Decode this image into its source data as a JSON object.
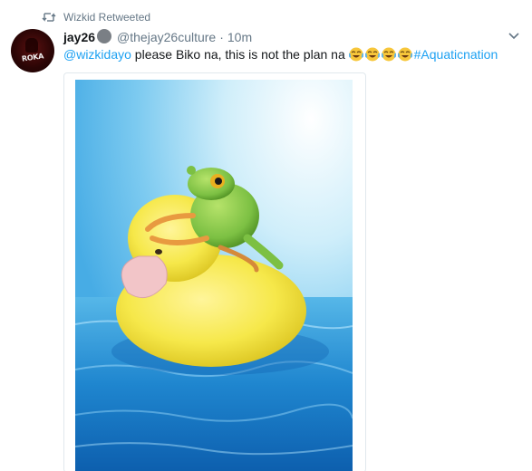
{
  "retweet": {
    "label": "Wizkid Retweeted",
    "icon": "retweet-icon"
  },
  "tweet": {
    "display_name": "jay26",
    "handle": "@thejay26culture",
    "separator": "·",
    "time": "10m",
    "avatar_text": "ROKA",
    "mention": "@wizkidayo",
    "body": " please Biko na, this is not the plan na ",
    "emoji": [
      "face-with-tears-of-joy",
      "face-with-tears-of-joy",
      "face-with-tears-of-joy",
      "face-with-tears-of-joy"
    ],
    "hashtag": "#Aquaticnation"
  },
  "colors": {
    "link": "#1da1f2",
    "muted": "#657786",
    "water": "#2f9ad6",
    "duckling": "#f6e84a",
    "frog": "#7cc043"
  }
}
